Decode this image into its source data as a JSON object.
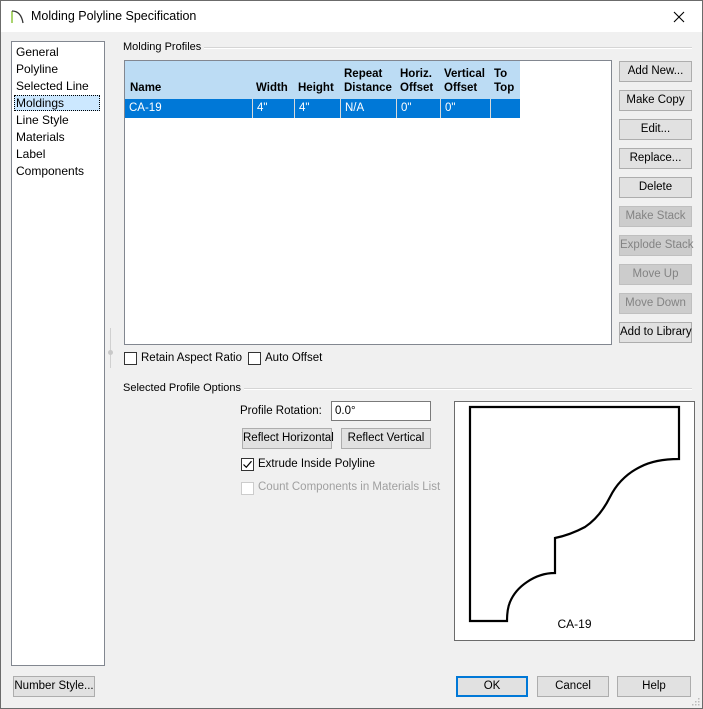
{
  "window": {
    "title": "Molding Polyline Specification",
    "app_icon": "arch-icon",
    "close_icon": "close-icon"
  },
  "sidebar": {
    "items": [
      {
        "label": "General",
        "selected": false
      },
      {
        "label": "Polyline",
        "selected": false
      },
      {
        "label": "Selected Line",
        "selected": false
      },
      {
        "label": "Moldings",
        "selected": true
      },
      {
        "label": "Line Style",
        "selected": false
      },
      {
        "label": "Materials",
        "selected": false
      },
      {
        "label": "Label",
        "selected": false
      },
      {
        "label": "Components",
        "selected": false
      }
    ]
  },
  "profiles": {
    "group_label": "Molding Profiles",
    "columns": [
      {
        "line1": "",
        "line2": "Name"
      },
      {
        "line1": "",
        "line2": "Width"
      },
      {
        "line1": "",
        "line2": "Height"
      },
      {
        "line1": "Repeat",
        "line2": "Distance"
      },
      {
        "line1": "Horiz.",
        "line2": "Offset"
      },
      {
        "line1": "Vertical",
        "line2": "Offset"
      },
      {
        "line1": "To",
        "line2": "Top"
      }
    ],
    "rows": [
      {
        "name": "CA-19",
        "width": "4\"",
        "height": "4\"",
        "repeat_distance": "N/A",
        "horiz_offset": "0\"",
        "vertical_offset": "0\"",
        "to_top": "",
        "selected": true
      }
    ],
    "buttons": [
      {
        "label": "Add New...",
        "enabled": true
      },
      {
        "label": "Make Copy",
        "enabled": true
      },
      {
        "label": "Edit...",
        "enabled": true
      },
      {
        "label": "Replace...",
        "enabled": true
      },
      {
        "label": "Delete",
        "enabled": true
      },
      {
        "label": "Make Stack",
        "enabled": false
      },
      {
        "label": "Explode Stack",
        "enabled": false
      },
      {
        "label": "Move Up",
        "enabled": false
      },
      {
        "label": "Move Down",
        "enabled": false
      },
      {
        "label": "Add to Library",
        "enabled": true
      }
    ],
    "retain_aspect_ratio": {
      "label": "Retain Aspect Ratio",
      "checked": false
    },
    "auto_offset": {
      "label": "Auto Offset",
      "checked": false
    }
  },
  "selected_options": {
    "group_label": "Selected Profile Options",
    "profile_rotation_label": "Profile Rotation:",
    "profile_rotation_value": "0.0°",
    "reflect_horizontal": "Reflect Horizontal",
    "reflect_vertical": "Reflect Vertical",
    "extrude_inside": {
      "label": "Extrude Inside Polyline",
      "checked": true,
      "enabled": true
    },
    "count_components": {
      "label": "Count Components in Materials List",
      "checked": false,
      "enabled": false
    },
    "preview_label": "CA-19"
  },
  "footer": {
    "number_style": "Number Style...",
    "ok": "OK",
    "cancel": "Cancel",
    "help": "Help"
  }
}
